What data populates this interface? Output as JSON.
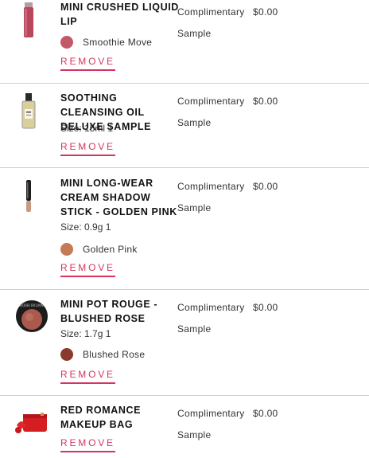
{
  "items": [
    {
      "name": "MINI CRUSHED LIQUID LIP",
      "size": "",
      "shade": "Smoothie Move",
      "shade_color": "#c4586b",
      "price_type": "Complimentary",
      "price": "$0.00",
      "sample_label": "Sample",
      "remove_label": "REMOVE",
      "icon": "liquid-lip-tube-icon"
    },
    {
      "name": "SOOTHING CLEANSING OIL DELUXE SAMPLE",
      "size": "Size: 15ml 1",
      "shade": "",
      "shade_color": "",
      "price_type": "Complimentary",
      "price": "$0.00",
      "sample_label": "Sample",
      "remove_label": "REMOVE",
      "icon": "cleansing-oil-bottle-icon"
    },
    {
      "name": "MINI LONG-WEAR CREAM SHADOW STICK - GOLDEN PINK",
      "size": "Size: 0.9g 1",
      "shade": "Golden Pink",
      "shade_color": "#c47a55",
      "price_type": "Complimentary",
      "price": "$0.00",
      "sample_label": "Sample",
      "remove_label": "REMOVE",
      "icon": "shadow-stick-icon"
    },
    {
      "name": "MINI POT ROUGE - BLUSHED ROSE",
      "size": "Size: 1.7g 1",
      "shade": "Blushed Rose",
      "shade_color": "#8a3a2c",
      "price_type": "Complimentary",
      "price": "$0.00",
      "sample_label": "Sample",
      "remove_label": "REMOVE",
      "icon": "pot-rouge-compact-icon"
    },
    {
      "name": "RED ROMANCE MAKEUP BAG",
      "size": "",
      "shade": "",
      "shade_color": "",
      "price_type": "Complimentary",
      "price": "$0.00",
      "sample_label": "Sample",
      "remove_label": "REMOVE",
      "icon": "makeup-bag-icon"
    }
  ],
  "colors": {
    "accent": "#d6335f",
    "divider": "#cfcfcf"
  }
}
